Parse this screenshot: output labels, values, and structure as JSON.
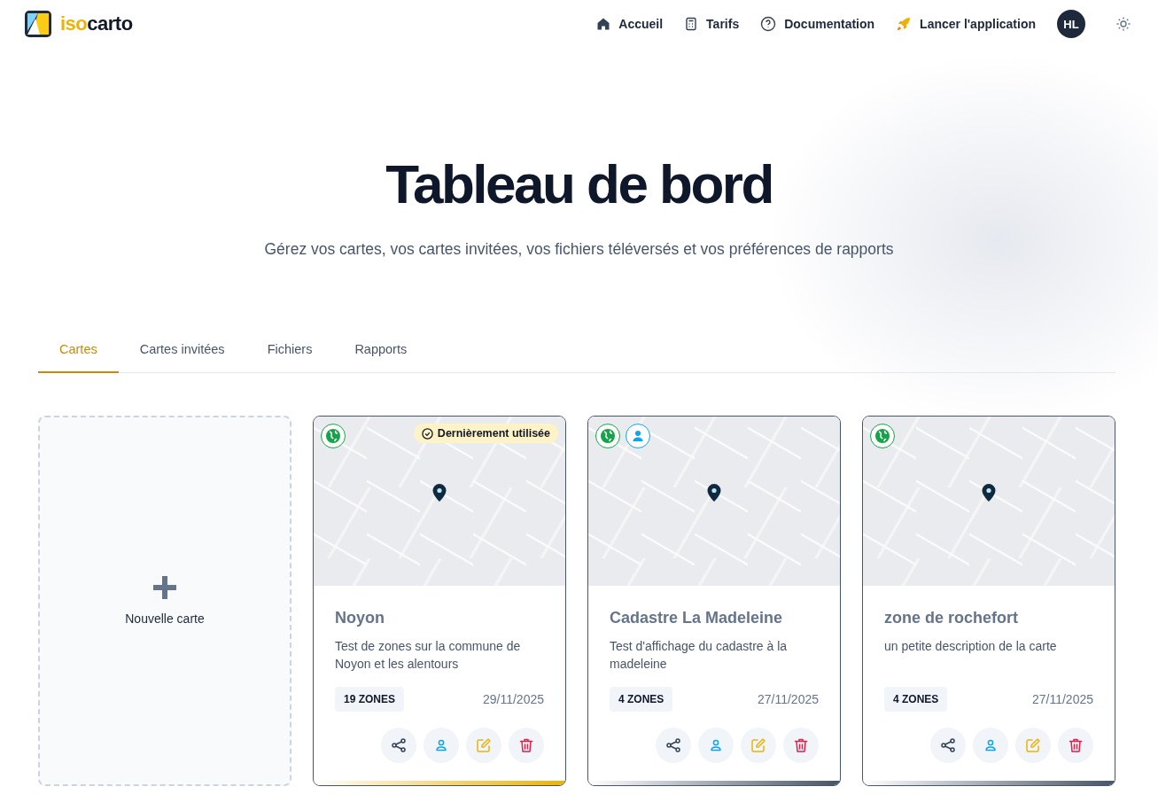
{
  "header": {
    "logo_text": "isocarto",
    "nav": [
      {
        "kind": "home",
        "label": "Accueil"
      },
      {
        "kind": "pricing",
        "label": "Tarifs"
      },
      {
        "kind": "help",
        "label": "Documentation"
      },
      {
        "kind": "rocket",
        "label": "Lancer l'application"
      }
    ],
    "avatar": "HL"
  },
  "hero": {
    "title": "Tableau de bord",
    "subtitle": "Gérez vos cartes, vos cartes invitées, vos fichiers téléversés et vos préférences de rapports"
  },
  "tabs": [
    {
      "label": "Cartes",
      "selected": true
    },
    {
      "label": "Cartes invitées",
      "selected": false
    },
    {
      "label": "Fichiers",
      "selected": false
    },
    {
      "label": "Rapports",
      "selected": false
    }
  ],
  "new_card": {
    "label": "Nouvelle carte"
  },
  "maps": [
    {
      "title": "Noyon",
      "description": "Test de zones sur la commune de Noyon et les alentours",
      "zones": "19 ZONES",
      "date": "29/11/2025",
      "public": true,
      "shared": false,
      "recent_badge": "Dernièrement utilisée",
      "recently_used": true
    },
    {
      "title": "Cadastre La Madeleine",
      "description": "Test d'affichage du cadastre à la madeleine",
      "zones": "4 ZONES",
      "date": "27/11/2025",
      "public": true,
      "shared": true,
      "recently_used": false
    },
    {
      "title": "zone de rochefort",
      "description": "un petite description de la carte",
      "zones": "4 ZONES",
      "date": "27/11/2025",
      "public": true,
      "shared": false,
      "recently_used": false
    }
  ]
}
